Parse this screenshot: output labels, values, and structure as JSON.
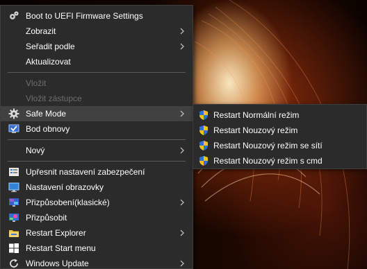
{
  "context_menu": {
    "items": [
      {
        "label": "Boot to UEFI Firmware Settings",
        "icon": "gear-cog-icon"
      },
      {
        "label": "Zobrazit",
        "submenu": true
      },
      {
        "label": "Seřadit podle",
        "submenu": true
      },
      {
        "label": "Aktualizovat"
      },
      {
        "label": "Vložit",
        "disabled": true
      },
      {
        "label": "Vložit zástupce",
        "disabled": true
      },
      {
        "label": "Safe Mode",
        "icon": "gear-icon",
        "submenu": true,
        "active": true
      },
      {
        "label": "Bod obnovy",
        "icon": "system-restore-icon"
      },
      {
        "label": "Nový",
        "submenu": true
      },
      {
        "label": "Upřesnit nastavení zabezpečení",
        "icon": "security-settings-icon"
      },
      {
        "label": "Nastavení obrazovky",
        "icon": "display-icon"
      },
      {
        "label": "Přizpůsobení(klasické)",
        "icon": "personalize-classic-icon",
        "submenu": true
      },
      {
        "label": "Přizpůsobit",
        "icon": "personalize-icon"
      },
      {
        "label": "Restart Explorer",
        "icon": "folder-icon",
        "submenu": true
      },
      {
        "label": "Restart Start menu",
        "icon": "windows-logo-icon"
      },
      {
        "label": "Windows Update",
        "icon": "refresh-icon",
        "submenu": true
      }
    ]
  },
  "safe_mode_submenu": {
    "items": [
      {
        "label": "Restart Normální režim",
        "icon": "uac-shield-icon"
      },
      {
        "label": "Restart Nouzový režim",
        "icon": "uac-shield-icon"
      },
      {
        "label": "Restart Nouzový režim se sítí",
        "icon": "uac-shield-icon"
      },
      {
        "label": "Restart Nouzový režim s cmd",
        "icon": "uac-shield-icon"
      }
    ]
  },
  "colors": {
    "menu_bg": "#2b2b2b",
    "hover_bg": "#414141",
    "text": "#ffffff",
    "disabled_text": "#6d6d6d",
    "separator": "#5a5a5a"
  }
}
